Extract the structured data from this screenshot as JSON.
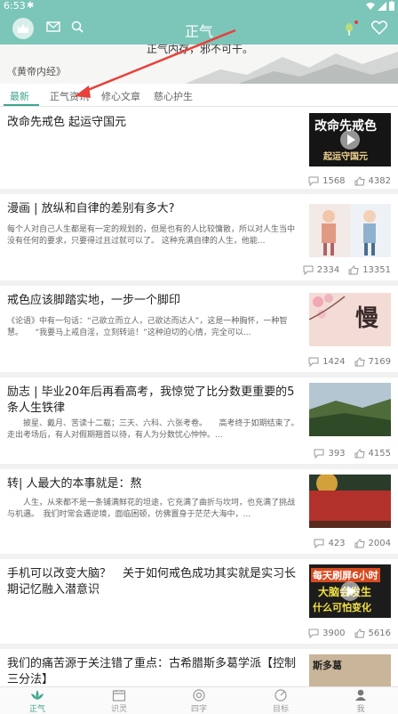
{
  "status": {
    "time": "6:53"
  },
  "app": {
    "title": "正气"
  },
  "banner": {
    "quote_top": "正气内存，邪不可干。",
    "source": "《黄帝内经》"
  },
  "tabs": [
    {
      "label": "最新"
    },
    {
      "label": "正气资讯"
    },
    {
      "label": "修心文章"
    },
    {
      "label": "慈心护生"
    }
  ],
  "articles": [
    {
      "title": "改命先戒色 起运守国元",
      "excerpt": "",
      "comments": "1568",
      "likes": "4382",
      "thumb": {
        "line1": "改命先戒色",
        "line2": "起运守国元"
      }
    },
    {
      "title": "漫画 | 放纵和自律的差别有多大?",
      "excerpt": "每个人对自己人生都是有一定的规划的，但是也有的人比较慵散，所以对人生当中没有任何的要求，只要得过且过就可以了。 这种充满自律的人生，他能...",
      "comments": "2334",
      "likes": "13351"
    },
    {
      "title": "戒色应该脚踏实地，一步一个脚印",
      "excerpt": "《论语》中有一句话：“己欲立而立人，己欲达而达人”，这是一种胸怀，一种智慧。　　“我要马上戒自淫，立刻转运！”这种迫切的心情，完全可以...",
      "comments": "1424",
      "likes": "7169",
      "thumb": {
        "line1": "慢"
      }
    },
    {
      "title": "励志 | 毕业20年后再看高考，我惊觉了比分数更重要的5条人生铁律",
      "excerpt": "　　披星、戴月、苦读十二载；三天、六科、六张考卷。　　高考终于如期结束了。　　走出考场后，有人对假期翘首以待，有人为分数忧心忡忡。...",
      "comments": "393",
      "likes": "4155"
    },
    {
      "title": "转| 人最大的本事就是：熬",
      "excerpt": "　　人生，从来都不是一条铺满鲜花的坦途，它充满了曲折与坎坷，也充满了挑战与机遇。　我们时常会遇逆境，面临困顿，仿佛置身于茫茫大海中，...",
      "comments": "423",
      "likes": "2004"
    },
    {
      "title": "手机可以改变大脑？　关于如何戒色成功其实就是实习长期记忆融入潜意识",
      "excerpt": "",
      "comments": "3900",
      "likes": "5616",
      "thumb": {
        "line1": "每天刷屏6小时",
        "line2": "大脑会发生",
        "line3": "什么可怕变化"
      }
    },
    {
      "title": "我们的痛苦源于关注错了重点：古希腊斯多葛学派【控制三分法】",
      "excerpt": "",
      "thumb": {
        "line1": "斯多葛"
      }
    }
  ],
  "nav": [
    {
      "label": "正气"
    },
    {
      "label": "识灵"
    },
    {
      "label": "四字"
    },
    {
      "label": "目标"
    },
    {
      "label": "我"
    }
  ],
  "colors": {
    "accent": "#3fa58f",
    "header": "#7cc6b9",
    "annotation": "#e8403a"
  }
}
